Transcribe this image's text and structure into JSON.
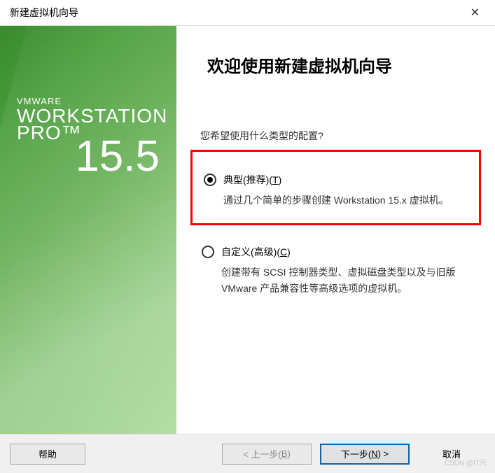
{
  "window": {
    "title": "新建虚拟机向导",
    "close_glyph": "✕"
  },
  "sidebar": {
    "brand_line1": "VMWARE",
    "brand_line2": "WORKSTATION",
    "brand_line3": "PRO™",
    "version": "15.5"
  },
  "main": {
    "heading": "欢迎使用新建虚拟机向导",
    "prompt": "您希望使用什么类型的配置?",
    "options": [
      {
        "label_prefix": "典型(推荐)(",
        "hotkey": "T",
        "label_suffix": ")",
        "description": "通过几个简单的步骤创建 Workstation 15.x 虚拟机。",
        "checked": true,
        "highlighted": true
      },
      {
        "label_prefix": "自定义(高级)(",
        "hotkey": "C",
        "label_suffix": ")",
        "description": "创建带有 SCSI 控制器类型、虚拟磁盘类型以及与旧版 VMware 产品兼容性等高级选项的虚拟机。",
        "checked": false,
        "highlighted": false
      }
    ]
  },
  "footer": {
    "help": "帮助",
    "back_prefix": "< 上一步(",
    "back_hotkey": "B",
    "back_suffix": ")",
    "next_prefix": "下一步(",
    "next_hotkey": "N",
    "next_suffix": ") >",
    "cancel": "取消"
  },
  "watermark": "CSDN @IT光"
}
